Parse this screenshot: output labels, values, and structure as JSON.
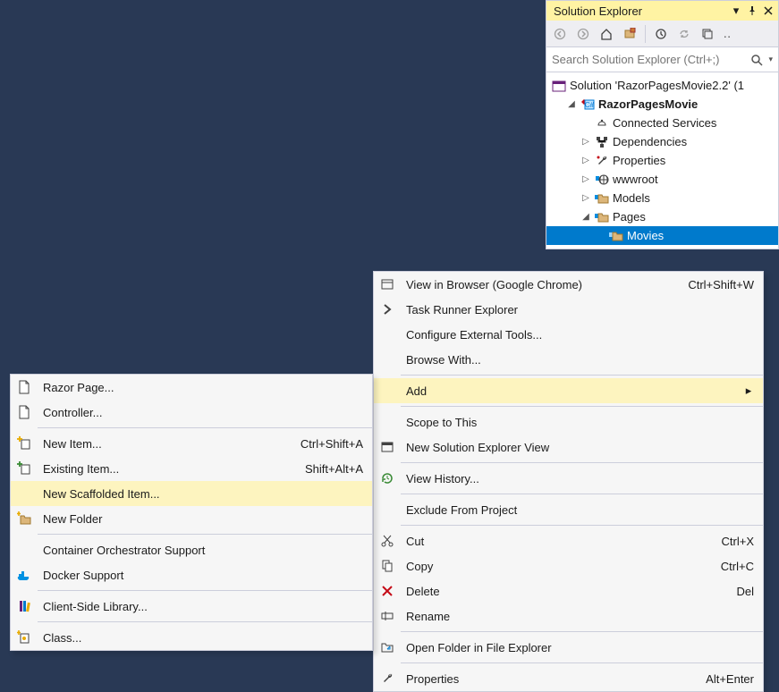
{
  "panel": {
    "title": "Solution Explorer",
    "search_placeholder": "Search Solution Explorer (Ctrl+;)",
    "tree": {
      "solution": "Solution 'RazorPagesMovie2.2' (1",
      "project": "RazorPagesMovie",
      "connected_services": "Connected Services",
      "dependencies": "Dependencies",
      "properties": "Properties",
      "wwwroot": "wwwroot",
      "models": "Models",
      "pages": "Pages",
      "movies": "Movies"
    }
  },
  "ctx_a": {
    "view_in_browser": "View in Browser (Google Chrome)",
    "view_in_browser_short": "Ctrl+Shift+W",
    "task_runner": "Task Runner Explorer",
    "config_ext": "Configure External Tools...",
    "browse_with": "Browse With...",
    "add": "Add",
    "scope": "Scope to This",
    "new_se_view": "New Solution Explorer View",
    "view_history": "View History...",
    "exclude": "Exclude From Project",
    "cut": "Cut",
    "cut_short": "Ctrl+X",
    "copy": "Copy",
    "copy_short": "Ctrl+C",
    "delete": "Delete",
    "delete_short": "Del",
    "rename": "Rename",
    "open_folder": "Open Folder in File Explorer",
    "properties": "Properties",
    "properties_short": "Alt+Enter"
  },
  "ctx_b": {
    "razor_page": "Razor Page...",
    "controller": "Controller...",
    "new_item": "New Item...",
    "new_item_short": "Ctrl+Shift+A",
    "existing_item": "Existing Item...",
    "existing_item_short": "Shift+Alt+A",
    "new_scaffolded": "New Scaffolded Item...",
    "new_folder": "New Folder",
    "container_orch": "Container Orchestrator Support",
    "docker": "Docker Support",
    "client_lib": "Client-Side Library...",
    "class": "Class..."
  }
}
